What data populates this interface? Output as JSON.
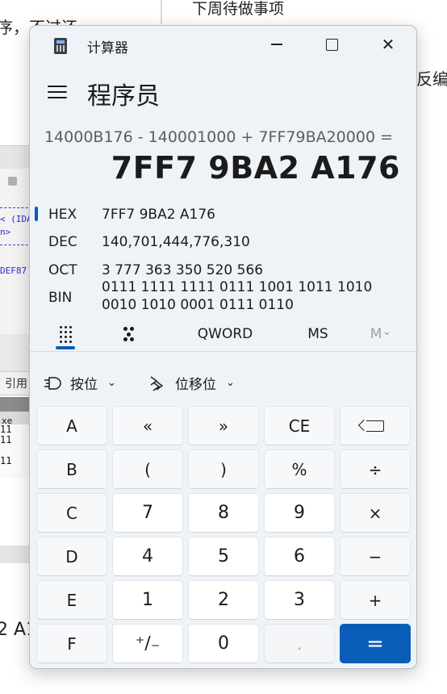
{
  "background": {
    "left_text_top": "序，不过还",
    "right_text_top": "下周待做事项",
    "right_text_mid": "反编",
    "code_line_1": "< (IDA",
    "code_line_2": "n>",
    "code_line_3": "DEF87",
    "ref_label": "引用",
    "table_header": "xe",
    "table_values": [
      "11",
      "11",
      "",
      "11"
    ],
    "bottom_text": "2 A1"
  },
  "window": {
    "title": "计算器",
    "app_icon": "calculator-icon",
    "minimize_icon": "minimize-icon",
    "maximize_icon": "maximize-icon",
    "close_glyph": "✕"
  },
  "header": {
    "menu_icon": "hamburger-menu-icon",
    "mode": "程序员"
  },
  "display": {
    "expression": "14000B176 - 140001000 + 7FF79BA20000 =",
    "result": "7FF7 9BA2 A176"
  },
  "radix": {
    "selected": "HEX",
    "hex": {
      "label": "HEX",
      "value": "7FF7 9BA2 A176"
    },
    "dec": {
      "label": "DEC",
      "value": "140,701,444,776,310"
    },
    "oct": {
      "label": "OCT",
      "value": "3 777 363 350 520 566"
    },
    "bin": {
      "label": "BIN",
      "value": "0111 1111 1111 0111 1001 1011 1010 0010 1010 0001 0111 0110"
    }
  },
  "tabs": {
    "keypad_icon": "full-keypad-icon",
    "bits_icon": "bit-toggle-keypad-icon",
    "word_size": "QWORD",
    "ms": "MS",
    "m_dropdown": "M",
    "m_chevron": "⌄"
  },
  "ops": {
    "bitwise_label": "按位",
    "bitwise_icon": "logic-gate-icon",
    "shift_label": "位移位",
    "shift_icon": "bit-shift-icon",
    "chevron": "⌄"
  },
  "keys": {
    "row1": [
      "A",
      "«",
      "»",
      "CE",
      ""
    ],
    "row2": [
      "B",
      "(",
      ")",
      "%",
      "÷"
    ],
    "row3": [
      "C",
      "7",
      "8",
      "9",
      "×"
    ],
    "row4": [
      "D",
      "4",
      "5",
      "6",
      "−"
    ],
    "row5": [
      "E",
      "1",
      "2",
      "3",
      "+"
    ],
    "row6": [
      "F",
      "⁺∕₋",
      "0",
      ".",
      "="
    ],
    "accent": "#0a5db6"
  }
}
